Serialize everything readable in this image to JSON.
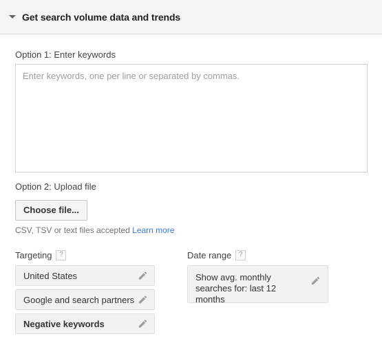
{
  "panel": {
    "title": "Get search volume data and trends",
    "disclosure_icon": "caret-down-icon",
    "expanded": true
  },
  "option1": {
    "label": "Option 1: Enter keywords",
    "textarea_value": "",
    "textarea_placeholder": "Enter keywords, one per line or separated by commas."
  },
  "option2": {
    "label": "Option 2: Upload file",
    "choose_file_label": "Choose file...",
    "hint_text": "CSV, TSV or text files accepted",
    "learn_more_label": "Learn more",
    "link_color": "#3b78e7"
  },
  "targeting": {
    "label": "Targeting",
    "help_icon": "question-mark-icon",
    "help_glyph": "?",
    "items": [
      {
        "label": "United States",
        "bold": false,
        "edit_icon": "pencil-icon"
      },
      {
        "label": "Google and search partners",
        "bold": false,
        "edit_icon": "pencil-icon"
      },
      {
        "label": "Negative keywords",
        "bold": true,
        "edit_icon": "pencil-icon"
      }
    ]
  },
  "date_range": {
    "label": "Date range",
    "help_icon": "question-mark-icon",
    "help_glyph": "?",
    "value": "Show avg. monthly searches for: last 12 months",
    "edit_icon": "pencil-icon"
  },
  "colors": {
    "header_bg": "#f5f5f5",
    "header_border": "#dcdcdc",
    "pill_bg": "#f2f2f2",
    "pill_border": "#e0e0e0",
    "text": "#333333",
    "muted_text": "#757575",
    "link": "#3b78e7"
  }
}
